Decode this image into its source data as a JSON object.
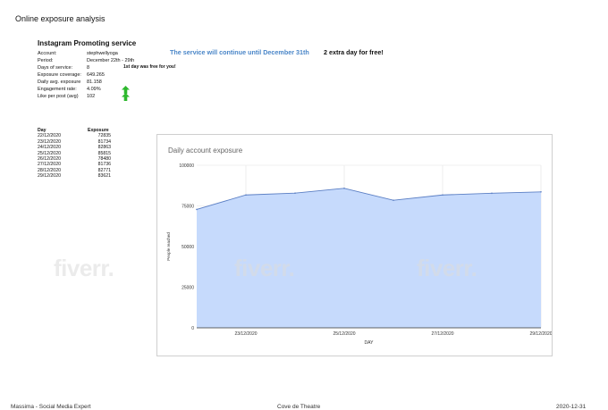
{
  "page_title": "Online exposure analysis",
  "service": {
    "title": "Instagram Promoting service",
    "rows": [
      {
        "label": "Account:",
        "value": "stephwellyoga"
      },
      {
        "label": "Period:",
        "value": "December 22th - 29th"
      },
      {
        "label": "Days of service:",
        "value": "8"
      },
      {
        "label": "Exposure coverage:",
        "value": "649.265"
      },
      {
        "label": "Daily avg. exposure",
        "value": "81.158"
      },
      {
        "label": "Engagement rate:",
        "value": "4.09%"
      },
      {
        "label": "Like per post (avg)",
        "value": "102"
      }
    ],
    "free_note": "1st day was free for you!",
    "continue_msg": "The service will continue until December 31th",
    "extra_msg": "2 extra day for free!",
    "arrow_color": "#2db82d",
    "arrow_icons": [
      "up-arrow-icon",
      "up-arrow-icon"
    ]
  },
  "table": {
    "headers": [
      "Day",
      "Exposure"
    ],
    "rows": [
      [
        "22/12/2020",
        "72835"
      ],
      [
        "23/12/2020",
        "81734"
      ],
      [
        "24/12/2020",
        "82863"
      ],
      [
        "25/12/2020",
        "85815"
      ],
      [
        "26/12/2020",
        "78480"
      ],
      [
        "27/12/2020",
        "81736"
      ],
      [
        "28/12/2020",
        "82771"
      ],
      [
        "29/12/2020",
        "83621"
      ]
    ]
  },
  "watermark_text": "fiverr.",
  "footer": {
    "left": "Massima - Social Media Expert",
    "center": "Cove de Theatre",
    "right": "2020-12-31"
  },
  "chart_data": {
    "type": "area",
    "title": "Daily account exposure",
    "xlabel": "DAY",
    "ylabel": "People reached",
    "x": [
      "22/12/2020",
      "23/12/2020",
      "24/12/2020",
      "25/12/2020",
      "26/12/2020",
      "27/12/2020",
      "28/12/2020",
      "29/12/2020"
    ],
    "xticks": [
      "23/12/2020",
      "25/12/2020",
      "27/12/2020",
      "29/12/2020"
    ],
    "series": [
      {
        "values": [
          72835,
          81734,
          82863,
          85815,
          78480,
          81736,
          82771,
          83621
        ]
      }
    ],
    "ylim": [
      0,
      100000
    ],
    "yticks": [
      0,
      25000,
      50000,
      75000,
      100000
    ],
    "grid": true,
    "fill_color": "#c6dafc",
    "line_color": "#5b7fc4"
  }
}
